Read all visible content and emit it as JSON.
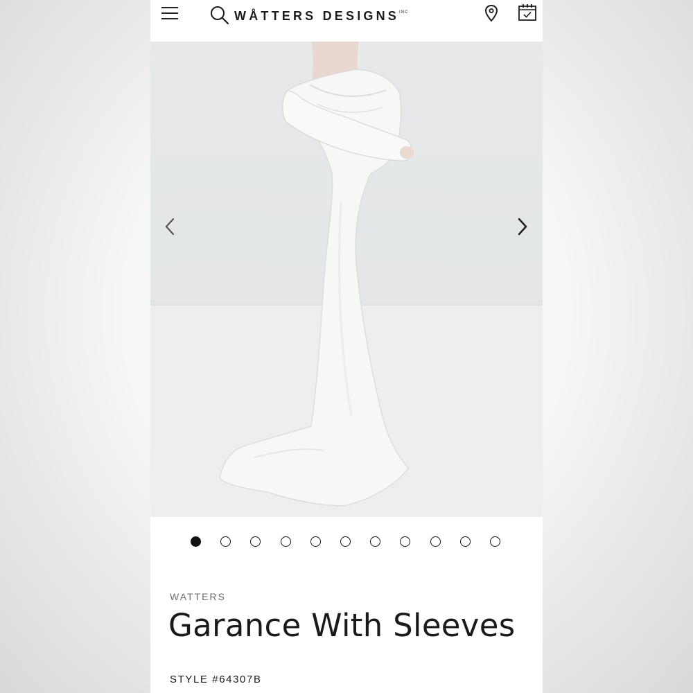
{
  "header": {
    "brand_name": "WÅTTERS DESIGNS",
    "brand_suffix": "INC",
    "icons": [
      "menu-icon",
      "search-icon",
      "location-pin-icon",
      "calendar-check-icon"
    ]
  },
  "gallery": {
    "slide_count": 11,
    "active_slide": 1,
    "prev_icon": "chevron-left-icon",
    "next_icon": "chevron-right-icon"
  },
  "product": {
    "designer": "WATTERS",
    "title": "Garance With Sleeves",
    "style_number": "STYLE #64307B"
  },
  "colors": {
    "text": "#1a1a1a",
    "muted": "#6d6d6d",
    "dot_active": "#111111",
    "photo_bg": "#e5e7e8"
  }
}
